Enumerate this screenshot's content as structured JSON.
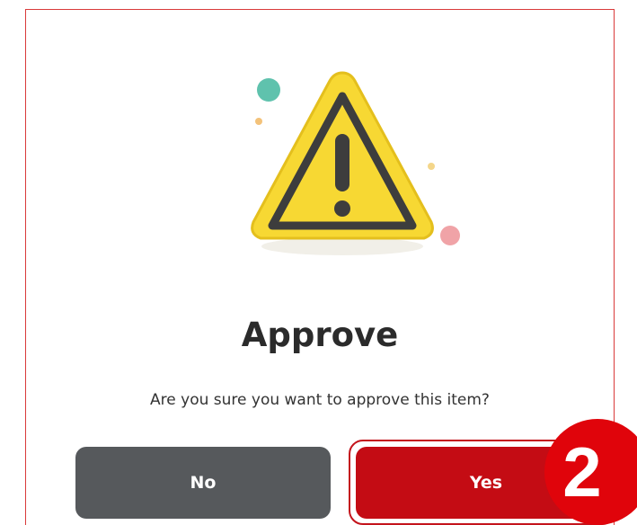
{
  "dialog": {
    "title": "Approve",
    "message": "Are you sure you want to approve this item?",
    "no_label": "No",
    "yes_label": "Yes",
    "icon": "warning-icon"
  },
  "annotation": {
    "step_number": "2"
  },
  "colors": {
    "border": "#d93a3a",
    "no_button": "#56595c",
    "yes_button": "#c40c14",
    "badge": "#e0040b",
    "warning_yellow": "#f7d833"
  }
}
